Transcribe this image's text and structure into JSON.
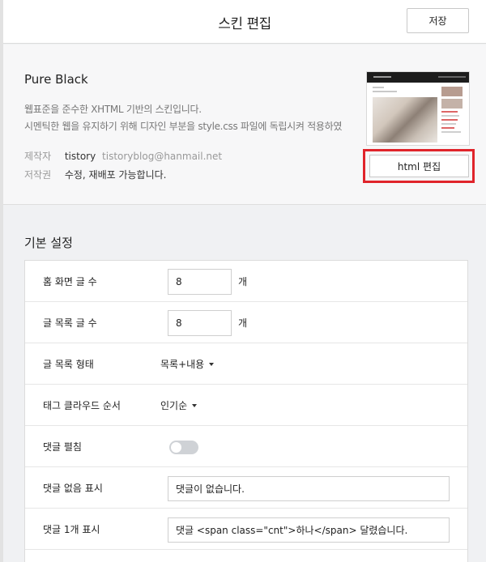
{
  "header": {
    "title": "스킨 편집",
    "save_label": "저장"
  },
  "skin": {
    "name": "Pure Black",
    "description_line1": "웹표준을 준수한 XHTML 기반의 스킨입니다.",
    "description_line2": "시멘틱한 웹을 유지하기 위해 디자인 부분을 style.css 파일에 독립시켜 적용하였",
    "author_label": "제작자",
    "author_name": "tistory",
    "author_email": "tistoryblog@hanmail.net",
    "copyright_label": "저작권",
    "copyright_value": "수정, 재배포 가능합니다.",
    "html_edit_label": "html 편집",
    "highlight_color": "#e0242b"
  },
  "basic_settings": {
    "title": "기본 설정",
    "home_posts": {
      "label": "홈 화면 글 수",
      "value": "8",
      "unit": "개"
    },
    "list_posts": {
      "label": "글 목록 글 수",
      "value": "8",
      "unit": "개"
    },
    "list_style": {
      "label": "글 목록 형태",
      "selected": "목록+내용"
    },
    "tag_cloud": {
      "label": "태그 클라우드 순서",
      "selected": "인기순"
    },
    "comment_expand": {
      "label": "댓글 펼침",
      "enabled": false
    },
    "no_comment": {
      "label": "댓글 없음 표시",
      "value": "댓글이 없습니다."
    },
    "one_comment": {
      "label": "댓글 1개 표시",
      "value": "댓글 <span class=\"cnt\">하나</span> 달렸습니다."
    }
  }
}
